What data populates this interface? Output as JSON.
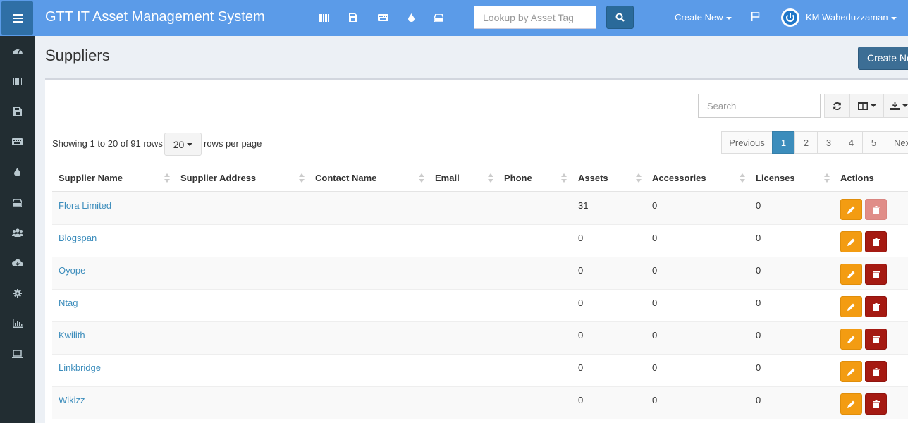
{
  "header": {
    "app_title": "GTT IT Asset Management System",
    "lookup_placeholder": "Lookup by Asset Tag",
    "create_new_label": "Create New",
    "user_name": "KM Waheduzzaman",
    "toolbar_icons": [
      "barcode-icon",
      "floppy-icon",
      "keyboard-icon",
      "drop-icon",
      "hdd-icon"
    ]
  },
  "sidebar": {
    "icons": [
      "dashboard-icon",
      "barcode-icon",
      "floppy-icon",
      "keyboard-icon",
      "drop-icon",
      "hdd-icon",
      "users-icon",
      "cloud-download-icon",
      "gear-icon",
      "bar-chart-icon",
      "laptop-icon"
    ]
  },
  "page": {
    "title": "Suppliers",
    "create_button": "Create New"
  },
  "table_tools": {
    "search_placeholder": "Search",
    "showing_text": "Showing 1 to 20 of 91 rows",
    "page_size": "20",
    "rows_per_page_text": "rows per page"
  },
  "pagination": {
    "previous": "Previous",
    "pages": [
      "1",
      "2",
      "3",
      "4",
      "5"
    ],
    "current": "1",
    "next": "Next"
  },
  "table": {
    "columns": [
      "Supplier Name",
      "Supplier Address",
      "Contact Name",
      "Email",
      "Phone",
      "Assets",
      "Accessories",
      "Licenses",
      "Actions"
    ],
    "rows": [
      {
        "name": "Flora Limited",
        "address": "",
        "contact": "",
        "email": "",
        "phone": "",
        "assets": "31",
        "accessories": "0",
        "licenses": "0",
        "delete_enabled": false
      },
      {
        "name": "Blogspan",
        "address": "",
        "contact": "",
        "email": "",
        "phone": "",
        "assets": "0",
        "accessories": "0",
        "licenses": "0",
        "delete_enabled": true
      },
      {
        "name": "Oyope",
        "address": "",
        "contact": "",
        "email": "",
        "phone": "",
        "assets": "0",
        "accessories": "0",
        "licenses": "0",
        "delete_enabled": true
      },
      {
        "name": "Ntag",
        "address": "",
        "contact": "",
        "email": "",
        "phone": "",
        "assets": "0",
        "accessories": "0",
        "licenses": "0",
        "delete_enabled": true
      },
      {
        "name": "Kwilith",
        "address": "",
        "contact": "",
        "email": "",
        "phone": "",
        "assets": "0",
        "accessories": "0",
        "licenses": "0",
        "delete_enabled": true
      },
      {
        "name": "Linkbridge",
        "address": "",
        "contact": "",
        "email": "",
        "phone": "",
        "assets": "0",
        "accessories": "0",
        "licenses": "0",
        "delete_enabled": true
      },
      {
        "name": "Wikizz",
        "address": "",
        "contact": "",
        "email": "",
        "phone": "",
        "assets": "0",
        "accessories": "0",
        "licenses": "0",
        "delete_enabled": true
      }
    ]
  },
  "colors": {
    "navbar": "#5b9be8",
    "sidebar": "#222d32",
    "link": "#3c8dbc",
    "edit_button": "#f39c12",
    "delete_button": "#a51a12"
  }
}
